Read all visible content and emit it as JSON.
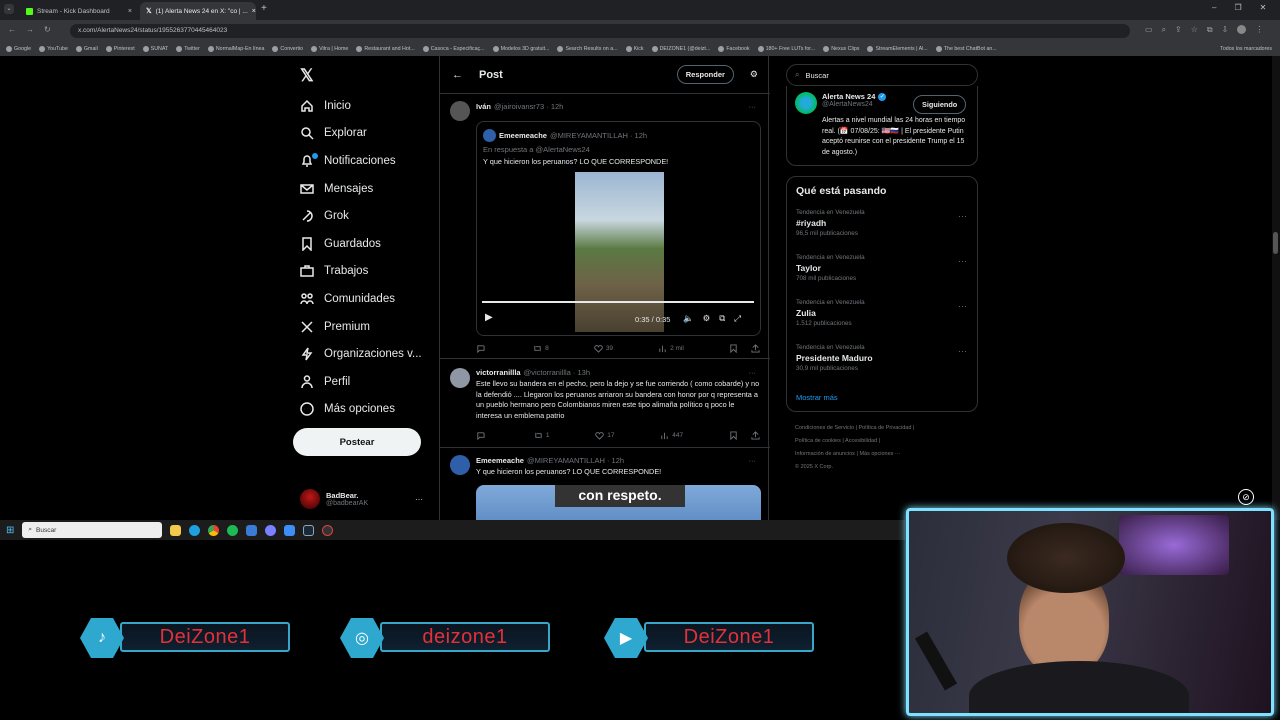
{
  "browser": {
    "tabs": [
      {
        "label": "Stream - Kick Dashboard",
        "icon": "kick-icon",
        "active": false
      },
      {
        "label": "(1) Alerta News 24 en X: \"co | ...",
        "icon": "x-logo-icon",
        "active": true
      }
    ],
    "new_tab": "+",
    "url": "x.com/AlertaNews24/status/1955263770445464023",
    "bookmarks": [
      "Google",
      "YouTube",
      "Gmail",
      "Pinterest",
      "SUNAT",
      "Twitter",
      "NormalMap-En línea",
      "Convertio",
      "Vitra | Home",
      "Restaurant and Hot...",
      "Casoca - Especificaç...",
      "Modelos 3D gratuit...",
      "Search Results on a...",
      "Kick",
      "DEIZONE1 (@deizt...",
      "Facebook",
      "180+ Free LUTs for...",
      "Nexus Clips",
      "StreamElements | Al...",
      "The best ChatBot an..."
    ],
    "all_bookmarks": "Todos los marcadores"
  },
  "nav": {
    "items": [
      {
        "label": "Inicio",
        "icon": "home-icon"
      },
      {
        "label": "Explorar",
        "icon": "search-icon"
      },
      {
        "label": "Notificaciones",
        "icon": "bell-icon"
      },
      {
        "label": "Mensajes",
        "icon": "mail-icon"
      },
      {
        "label": "Grok",
        "icon": "grok-icon"
      },
      {
        "label": "Guardados",
        "icon": "bookmark-icon"
      },
      {
        "label": "Trabajos",
        "icon": "briefcase-icon"
      },
      {
        "label": "Comunidades",
        "icon": "people-icon"
      },
      {
        "label": "Premium",
        "icon": "x-logo-icon"
      },
      {
        "label": "Organizaciones v...",
        "icon": "lightning-icon"
      },
      {
        "label": "Perfil",
        "icon": "person-icon"
      },
      {
        "label": "Más opciones",
        "icon": "more-circle-icon"
      }
    ],
    "post_button": "Postear",
    "account_name": "BadBear.",
    "account_handle": "@badbearAK",
    "account_more": "···"
  },
  "main": {
    "back": "←",
    "title": "Post",
    "reply_button": "Responder",
    "tweets": [
      {
        "name": "Iván",
        "handle": "@jairoivansr73 · 12h",
        "more": "···",
        "quoted": {
          "name": "Emeemeache",
          "handle": "@MIREYAMANTILLAH · 12h",
          "reply_to": "En respuesta a @AlertaNews24",
          "text": "Y que hicieron los peruanos? LO QUE CORRESPONDE!",
          "video_time": "0:35 / 0:35"
        },
        "stats": {
          "replies": "",
          "retweets": "8",
          "likes": "39",
          "views": "2 mil"
        }
      },
      {
        "name": "victorranillla",
        "handle": "@victorranillla · 13h",
        "more": "···",
        "text": "Este llevo su bandera en el pecho, pero la dejo y se fue corriendo ( como cobarde) y no la defendió .... Llegaron los peruanos arriaron su bandera con honor por q representa a un pueblo hermano pero Colombianos miren este tipo alimaña político q poco le interesa un emblema patrio",
        "stats": {
          "replies": "",
          "retweets": "1",
          "likes": "17",
          "views": "447"
        }
      },
      {
        "name": "Emeemeache",
        "handle": "@MIREYAMANTILLAH · 12h",
        "more": "···",
        "text": "Y que hicieron los peruanos? LO QUE CORRESPONDE!",
        "caption": "con respeto."
      }
    ]
  },
  "right": {
    "search_placeholder": "Buscar",
    "profile": {
      "name": "Alerta News 24",
      "handle": "@AlertaNews24",
      "follow_button": "Siguiendo",
      "bio": "Alertas a nivel mundial las 24 horas en tiempo real. (📅 07/08/25: 🇺🇸🇷🇺 | El presidente Putin aceptó reunirse con el presidente Trump el 15 de agosto.)"
    },
    "trends_title": "Qué está pasando",
    "trends": [
      {
        "meta": "Tendencia en Venezuela",
        "name": "#riyadh",
        "count": "96,5 mil publicaciones"
      },
      {
        "meta": "Tendencia en Venezuela",
        "name": "Taylor",
        "count": "708 mil publicaciones"
      },
      {
        "meta": "Tendencia en Venezuela",
        "name": "Zulia",
        "count": "1.512 publicaciones"
      },
      {
        "meta": "Tendencia en Venezuela",
        "name": "Presidente Maduro",
        "count": "30,9 mil publicaciones"
      }
    ],
    "show_more": "Mostrar más",
    "footer": [
      "Condiciones de Servicio",
      "Política de Privacidad",
      "Política de cookies",
      "Accesibilidad",
      "Información de anuncios",
      "Más opciones ···",
      "© 2025 X Corp."
    ]
  },
  "taskbar": {
    "search": "Buscar"
  },
  "overlay": {
    "socials": [
      {
        "platform": "tiktok-icon",
        "handle": "DeiZone1"
      },
      {
        "platform": "instagram-icon",
        "handle": "deizone1"
      },
      {
        "platform": "youtube-icon",
        "handle": "DeiZone1"
      }
    ]
  }
}
